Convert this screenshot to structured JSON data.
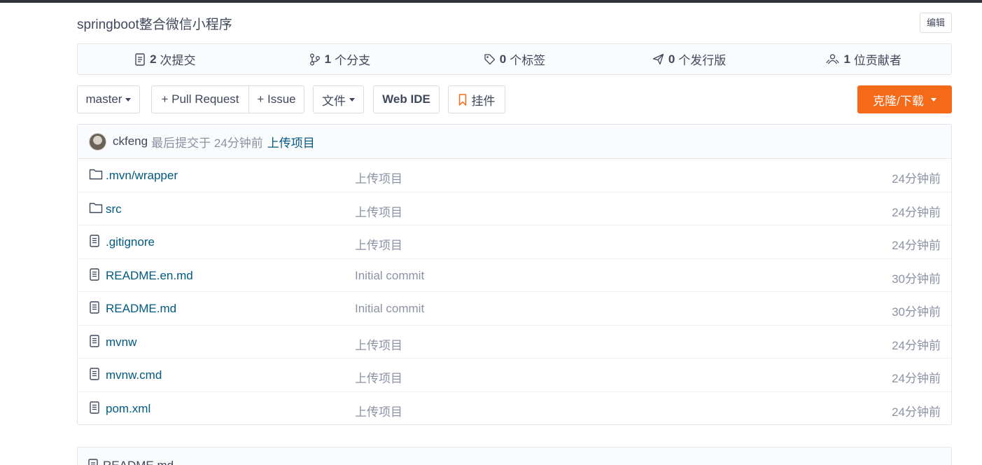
{
  "repo": {
    "title": "springboot整合微信小程序",
    "edit_label": "编辑"
  },
  "stats": [
    {
      "icon": "commits-icon",
      "count": "2",
      "label": "次提交"
    },
    {
      "icon": "branch-icon",
      "count": "1",
      "label": "个分支"
    },
    {
      "icon": "tag-icon",
      "count": "0",
      "label": "个标签"
    },
    {
      "icon": "release-icon",
      "count": "0",
      "label": "个发行版"
    },
    {
      "icon": "contributors-icon",
      "count": "1",
      "label": "位贡献者"
    }
  ],
  "toolbar": {
    "branch": "master",
    "pull_request": "+ Pull Request",
    "issue": "+ Issue",
    "file_menu": "文件",
    "web_ide": "Web IDE",
    "widget": "挂件",
    "clone": "克隆/下载"
  },
  "colors": {
    "accent": "#f56a18",
    "link": "#005980",
    "muted": "#8c92a4",
    "text": "#40485b"
  },
  "latest_commit": {
    "author": "ckfeng",
    "time_text": "最后提交于 24分钟前",
    "message": "上传项目"
  },
  "files": [
    {
      "type": "folder",
      "name": ".mvn/wrapper",
      "message": "上传项目",
      "time": "24分钟前"
    },
    {
      "type": "folder",
      "name": "src",
      "message": "上传项目",
      "time": "24分钟前"
    },
    {
      "type": "file",
      "name": ".gitignore",
      "message": "上传项目",
      "time": "24分钟前"
    },
    {
      "type": "file",
      "name": "README.en.md",
      "message": "Initial commit",
      "time": "30分钟前"
    },
    {
      "type": "file",
      "name": "README.md",
      "message": "Initial commit",
      "time": "30分钟前"
    },
    {
      "type": "file",
      "name": "mvnw",
      "message": "上传项目",
      "time": "24分钟前"
    },
    {
      "type": "file",
      "name": "mvnw.cmd",
      "message": "上传项目",
      "time": "24分钟前"
    },
    {
      "type": "file",
      "name": "pom.xml",
      "message": "上传项目",
      "time": "24分钟前"
    }
  ],
  "readme": {
    "title": "README.md"
  }
}
